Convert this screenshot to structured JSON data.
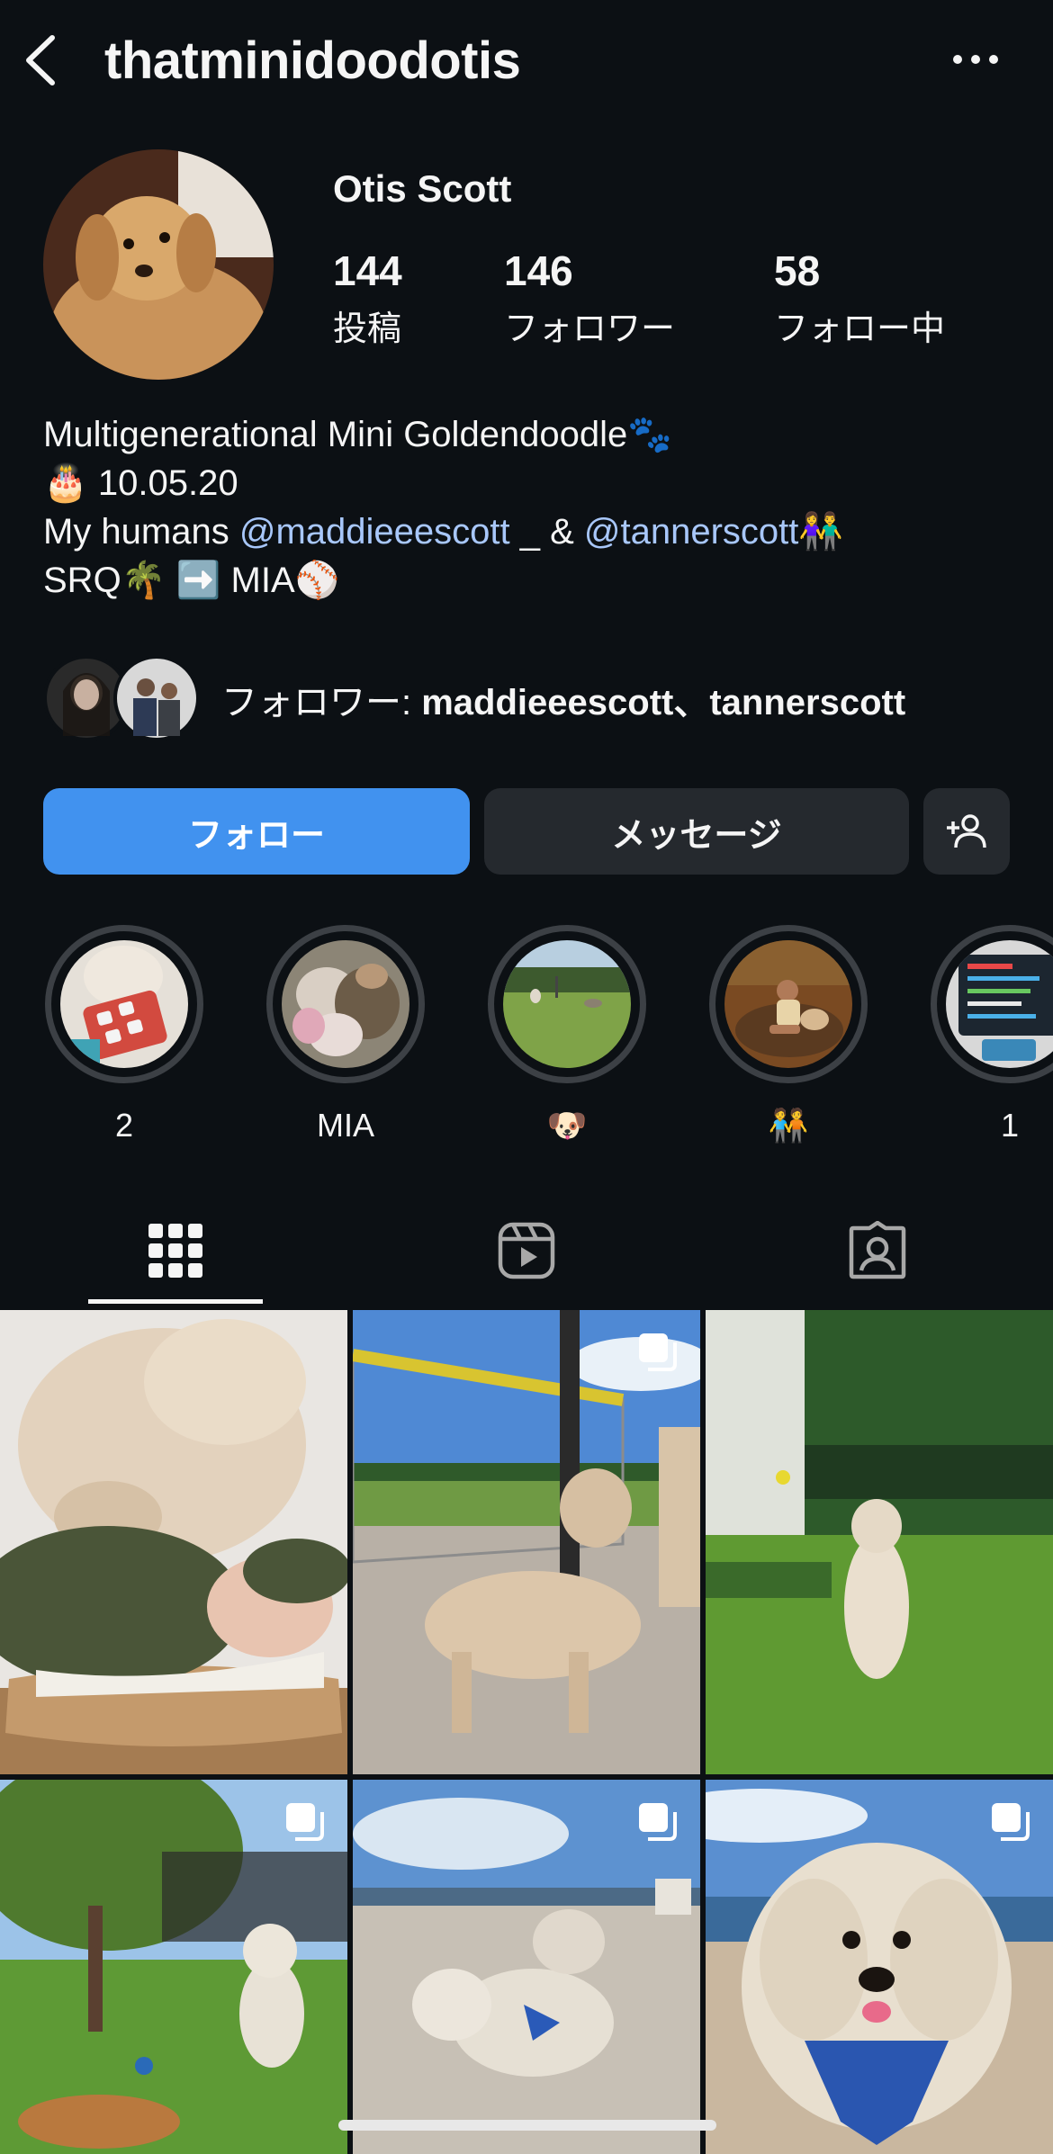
{
  "header": {
    "username": "thatminidoodotis",
    "back_icon": "chevron-left-icon",
    "more_icon": "ellipsis-icon"
  },
  "profile": {
    "display_name": "Otis Scott",
    "stats": [
      {
        "value": "144",
        "label": "投稿"
      },
      {
        "value": "146",
        "label": "フォロワー"
      },
      {
        "value": "58",
        "label": "フォロー中"
      }
    ],
    "bio": {
      "line1": "Multigenerational Mini Goldendoodle🐾",
      "line2": "🎂 10.05.20",
      "line3_prefix": "My humans ",
      "mention1": "@maddieeescott",
      "line3_mid": " _ & ",
      "mention2": "@tannerscott",
      "line3_suffix": "👫",
      "line4": "SRQ🌴 ➡️ MIA⚾️"
    },
    "followed_by_prefix": "フォロワー: ",
    "followed_by_names": "maddieeescott、tannerscott"
  },
  "actions": {
    "follow_label": "フォロー",
    "message_label": "メッセージ",
    "add_user_icon": "person-add-icon"
  },
  "highlights": [
    {
      "label": "2"
    },
    {
      "label": "MIA"
    },
    {
      "label": "🐶"
    },
    {
      "label": "🧑‍🤝‍🧑"
    },
    {
      "label": "1"
    }
  ],
  "tabs": [
    {
      "name": "grid",
      "icon": "grid-icon",
      "active": true
    },
    {
      "name": "reels",
      "icon": "reels-icon",
      "active": false
    },
    {
      "name": "tagged",
      "icon": "tagged-icon",
      "active": false
    }
  ],
  "colors": {
    "background": "#0c1014",
    "accent": "#4192ef",
    "mention": "#a8c7fa",
    "secondary_button": "#25292e"
  }
}
